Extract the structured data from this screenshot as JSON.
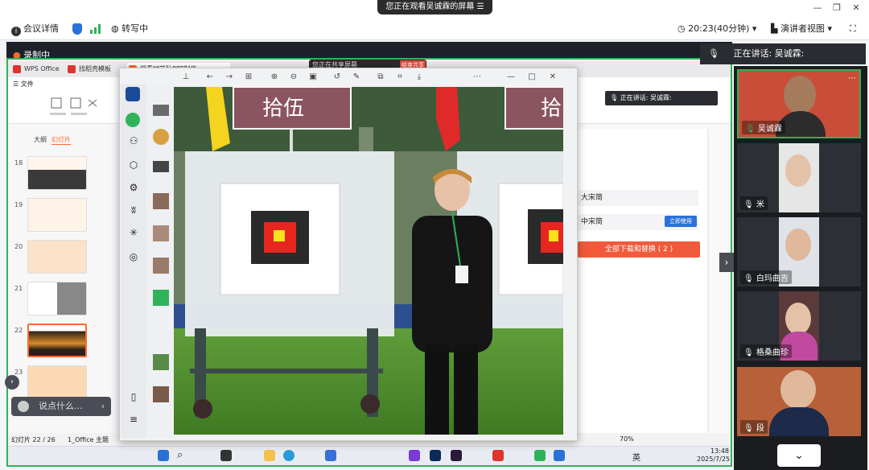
{
  "top": {
    "viewing_banner": "您正在观看吴诚霖的屏幕",
    "meeting_info": "会议详情",
    "transcribe": "转写中",
    "time_label": "20:23(40分钟)",
    "presenter_view": "演讲者视图"
  },
  "share": {
    "recording": "录制中",
    "sharing_text": "您正在共享屏幕",
    "stop_share": "结束共享",
    "speaking_label": "正在讲话:",
    "speaker_name": "吴诚霖:"
  },
  "wps": {
    "tabs": [
      "WPS Office",
      "找稻壳模板",
      "观看时艺队PPT制作..."
    ],
    "file_menu": "文件",
    "panel_tabs": [
      "大纲",
      "幻灯片"
    ],
    "slide_numbers": [
      "18",
      "19",
      "20",
      "21",
      "22",
      "23"
    ],
    "status_slide": "幻灯片 22 / 26",
    "status_theme": "1_Office 主题",
    "zoom": "70%",
    "right_panel_items": [
      "大宋简",
      "中宋简"
    ],
    "apply_button": "立即使用",
    "download_all": "全部下载和替换 ( 2 )"
  },
  "photo": {
    "sign_text": "拾伍",
    "sign_text_2": "拾"
  },
  "participants": [
    {
      "name": "吴诚霖"
    },
    {
      "name": "米"
    },
    {
      "name": "白玛曲吉"
    },
    {
      "name": "格桑曲珍"
    },
    {
      "name": "段"
    }
  ],
  "toast": {
    "placeholder": "说点什么..."
  },
  "taskbar": {
    "clock_time": "13:48",
    "clock_date": "2025/7/25",
    "ime": "英"
  },
  "colors": {
    "accent_green": "#2fb35a",
    "stop_red": "#e24a3a",
    "wps_orange": "#ff6a2b"
  }
}
